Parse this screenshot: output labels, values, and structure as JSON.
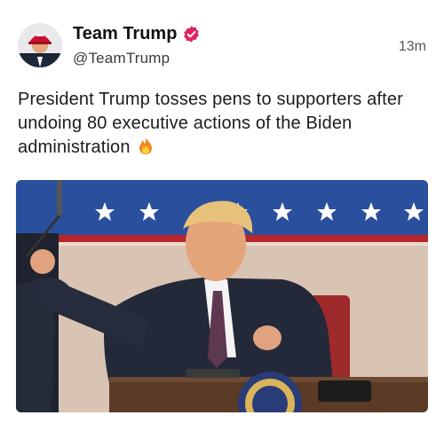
{
  "post": {
    "author": {
      "display_name": "Team Trump",
      "handle": "@TeamTrump",
      "verified": true,
      "avatar_icon": "avatar-icon",
      "verified_icon": "verified-badge-icon"
    },
    "timestamp": "13m",
    "text": "President Trump tosses pens to supporters after undoing 80 executive actions of the Biden administration",
    "text_emoji": "fire-icon",
    "media": {
      "type": "image",
      "icon": "photo-icon"
    }
  },
  "colors": {
    "verified_badge": "#e0245e",
    "banner_blue": "#2a4f9c",
    "banner_red": "#b8262b"
  }
}
